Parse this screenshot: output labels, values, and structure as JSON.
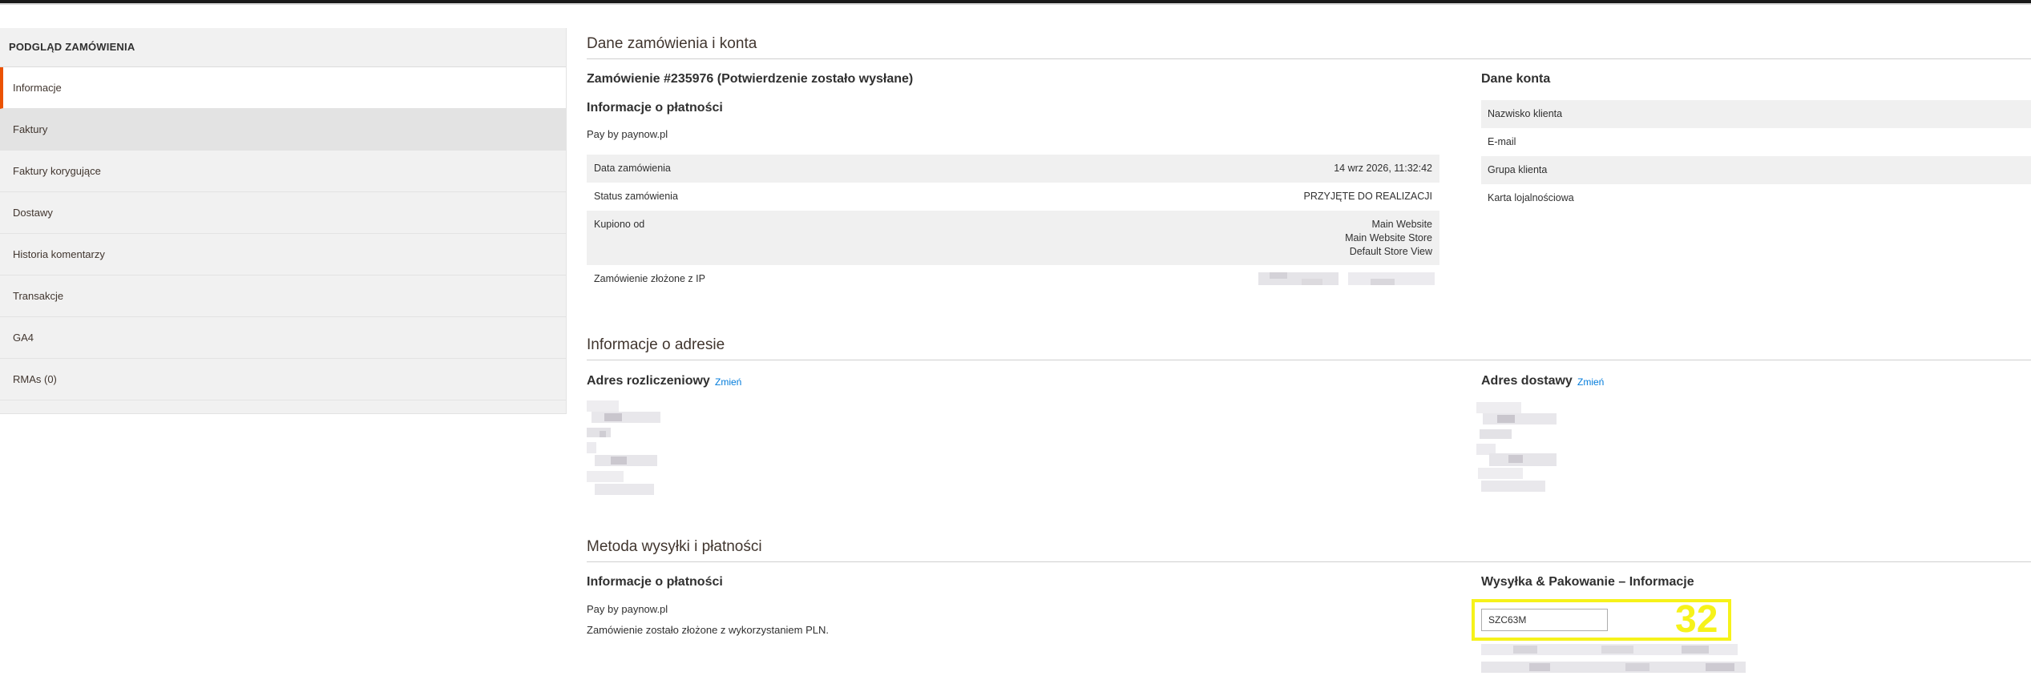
{
  "sidebar": {
    "title": "PODGLĄD ZAMÓWIENIA",
    "tabs": [
      {
        "label": "Informacje"
      },
      {
        "label": "Faktury"
      },
      {
        "label": "Faktury korygujące"
      },
      {
        "label": "Dostawy"
      },
      {
        "label": "Historia komentarzy"
      },
      {
        "label": "Transakcje"
      },
      {
        "label": "GA4"
      },
      {
        "label": "RMAs (0)"
      }
    ]
  },
  "order_section": {
    "title": "Dane zamówienia i konta",
    "order_heading": "Zamówienie #235976 (Potwierdzenie zostało wysłane)",
    "payment_heading": "Informacje o płatności",
    "payment_method": "Pay by paynow.pl",
    "rows": {
      "date_label": "Data zamówienia",
      "date_value": "14 wrz 2026, 11:32:42",
      "status_label": "Status zamówienia",
      "status_value": "PRZYJĘTE DO REALIZACJI",
      "purchased_label": "Kupiono od",
      "purchased_line1": "Main Website",
      "purchased_line2": "Main Website Store",
      "purchased_line3": "Default Store View",
      "ip_label": "Zamówienie złożone z IP"
    }
  },
  "account": {
    "heading": "Dane konta",
    "rows": [
      "Nazwisko klienta",
      "E-mail",
      "Grupa klienta",
      "Karta lojalnościowa"
    ]
  },
  "address_section": {
    "title": "Informacje o adresie",
    "billing_heading": "Adres rozliczeniowy",
    "billing_edit": "Zmień",
    "shipping_heading": "Adres dostawy",
    "shipping_edit": "Zmień"
  },
  "shipping_section": {
    "title": "Metoda wysyłki i płatności",
    "payment_heading": "Informacje o płatności",
    "payment_method": "Pay by paynow.pl",
    "currency_note": "Zamówienie zostało złożone z wykorzystaniem PLN.",
    "shipping_heading": "Wysyłka & Pakowanie – Informacje",
    "tracking_value": "SZC63M",
    "annotation_number": "32"
  },
  "colors": {
    "accent": "#eb5202",
    "link": "#007bdb",
    "highlight": "#f6f21a"
  }
}
